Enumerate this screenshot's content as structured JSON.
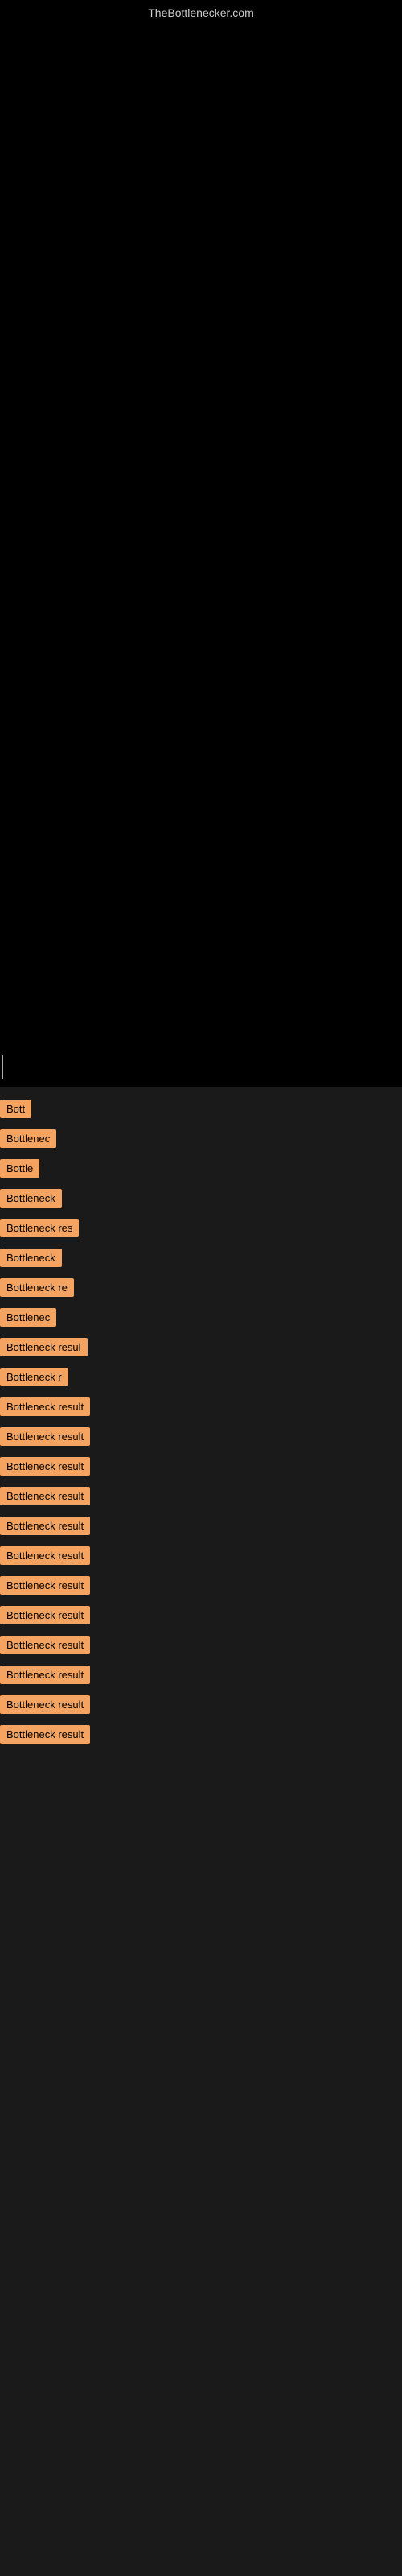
{
  "site": {
    "title": "TheBottlenecker.com"
  },
  "items": [
    {
      "id": 1,
      "label": "Bott"
    },
    {
      "id": 2,
      "label": "Bottlenec"
    },
    {
      "id": 3,
      "label": "Bottle"
    },
    {
      "id": 4,
      "label": "Bottleneck"
    },
    {
      "id": 5,
      "label": "Bottleneck res"
    },
    {
      "id": 6,
      "label": "Bottleneck"
    },
    {
      "id": 7,
      "label": "Bottleneck re"
    },
    {
      "id": 8,
      "label": "Bottlenec"
    },
    {
      "id": 9,
      "label": "Bottleneck resul"
    },
    {
      "id": 10,
      "label": "Bottleneck r"
    },
    {
      "id": 11,
      "label": "Bottleneck result"
    },
    {
      "id": 12,
      "label": "Bottleneck result"
    },
    {
      "id": 13,
      "label": "Bottleneck result"
    },
    {
      "id": 14,
      "label": "Bottleneck result"
    },
    {
      "id": 15,
      "label": "Bottleneck result"
    },
    {
      "id": 16,
      "label": "Bottleneck result"
    },
    {
      "id": 17,
      "label": "Bottleneck result"
    },
    {
      "id": 18,
      "label": "Bottleneck result"
    },
    {
      "id": 19,
      "label": "Bottleneck result"
    },
    {
      "id": 20,
      "label": "Bottleneck result"
    },
    {
      "id": 21,
      "label": "Bottleneck result"
    },
    {
      "id": 22,
      "label": "Bottleneck result"
    }
  ]
}
